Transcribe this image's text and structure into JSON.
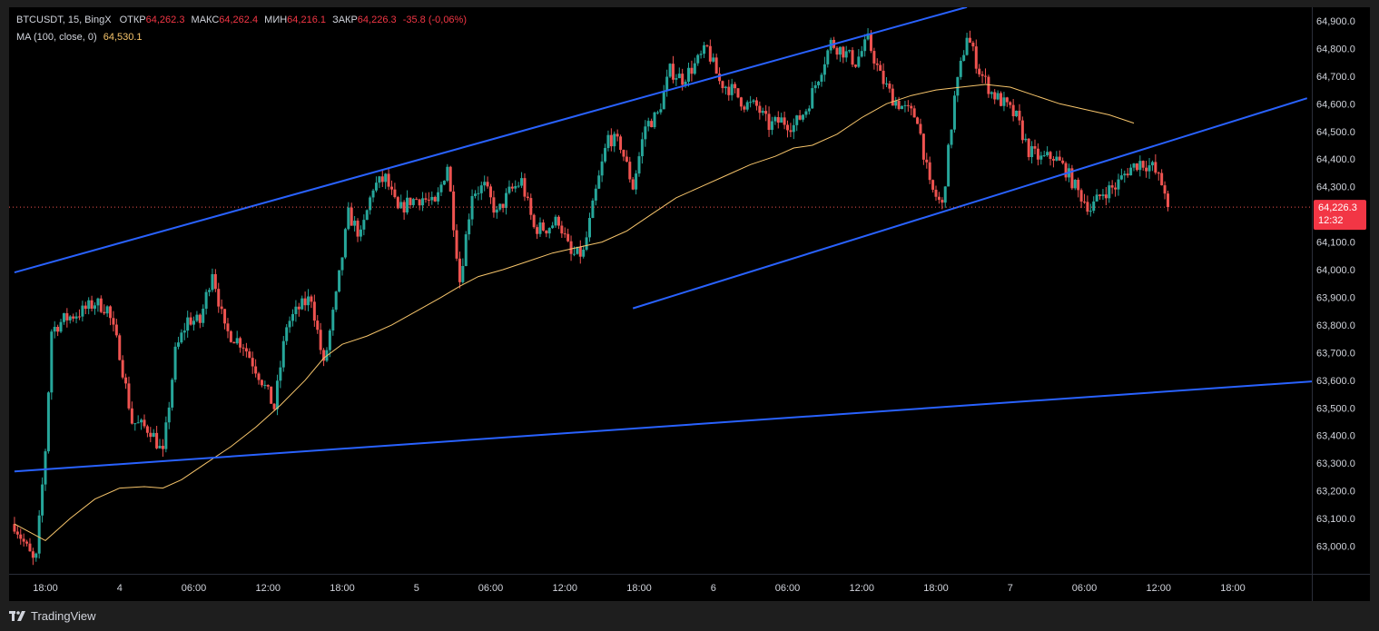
{
  "legend": {
    "symbol": "BTCUSDT, 15, BingX",
    "open_label": "ОТКР",
    "open_value": "64,262.3",
    "high_label": "МАКС",
    "high_value": "64,262.4",
    "low_label": "МИН",
    "low_value": "64,216.1",
    "close_label": "ЗАКР",
    "close_value": "64,226.3",
    "change": "-35.8 (-0,06%)",
    "ma_label": "MA (100, close, 0)",
    "ma_value": "64,530.1"
  },
  "price_badge": {
    "price": "64,226.3",
    "countdown": "12:32"
  },
  "footer": {
    "brand": "TradingView"
  },
  "colors": {
    "up": "#26a69a",
    "down": "#ef5350",
    "ma": "#f7c56b",
    "trendline": "#2962ff",
    "background": "#000000",
    "axis_text": "#d1d4dc"
  },
  "chart_data": {
    "type": "candlestick",
    "interval": "15",
    "y_ticks": [
      "63,000.0",
      "63,100.0",
      "63,200.0",
      "63,300.0",
      "63,400.0",
      "63,500.0",
      "63,600.0",
      "63,700.0",
      "63,800.0",
      "63,900.0",
      "64,000.0",
      "64,100.0",
      "64,200.0",
      "64,300.0",
      "64,400.0",
      "64,500.0",
      "64,600.0",
      "64,700.0",
      "64,800.0",
      "64,900.0"
    ],
    "y_tick_values": [
      63000,
      63100,
      63200,
      63300,
      63400,
      63500,
      63600,
      63700,
      63800,
      63900,
      64000,
      64100,
      64200,
      64300,
      64400,
      64500,
      64600,
      64700,
      64800,
      64900
    ],
    "x_ticks": [
      {
        "label": "18:00",
        "hour": 0
      },
      {
        "label": "4",
        "hour": 6
      },
      {
        "label": "06:00",
        "hour": 12
      },
      {
        "label": "12:00",
        "hour": 18
      },
      {
        "label": "18:00",
        "hour": 24
      },
      {
        "label": "5",
        "hour": 30
      },
      {
        "label": "06:00",
        "hour": 36
      },
      {
        "label": "12:00",
        "hour": 42
      },
      {
        "label": "18:00",
        "hour": 48
      },
      {
        "label": "6",
        "hour": 54
      },
      {
        "label": "06:00",
        "hour": 60
      },
      {
        "label": "12:00",
        "hour": 66
      },
      {
        "label": "18:00",
        "hour": 72
      },
      {
        "label": "7",
        "hour": 78
      },
      {
        "label": "06:00",
        "hour": 84
      },
      {
        "label": "12:00",
        "hour": 90
      },
      {
        "label": "18:00",
        "hour": 96
      }
    ],
    "y_range": [
      62900,
      64940
    ],
    "last_close": 64226.3,
    "price_path": [
      [
        -2.5,
        63080
      ],
      [
        -0.8,
        62930
      ],
      [
        0,
        63350
      ],
      [
        0.5,
        63780
      ],
      [
        1.5,
        63820
      ],
      [
        3,
        63850
      ],
      [
        4,
        63880
      ],
      [
        5,
        63860
      ],
      [
        6,
        63700
      ],
      [
        7,
        63450
      ],
      [
        8.5,
        63420
      ],
      [
        9.5,
        63330
      ],
      [
        10.5,
        63700
      ],
      [
        11.5,
        63820
      ],
      [
        12.5,
        63810
      ],
      [
        13.5,
        64000
      ],
      [
        14.5,
        63780
      ],
      [
        16,
        63730
      ],
      [
        17.5,
        63600
      ],
      [
        18.5,
        63500
      ],
      [
        19.5,
        63800
      ],
      [
        20.5,
        63860
      ],
      [
        21.5,
        63900
      ],
      [
        22.5,
        63650
      ],
      [
        23.5,
        63900
      ],
      [
        24.5,
        64200
      ],
      [
        25.5,
        64120
      ],
      [
        26.5,
        64300
      ],
      [
        27.5,
        64330
      ],
      [
        28.5,
        64210
      ],
      [
        29.5,
        64250
      ],
      [
        30.5,
        64260
      ],
      [
        31.5,
        64230
      ],
      [
        32.5,
        64380
      ],
      [
        33.5,
        63960
      ],
      [
        34.5,
        64280
      ],
      [
        35.5,
        64300
      ],
      [
        36.5,
        64200
      ],
      [
        37.5,
        64280
      ],
      [
        38.5,
        64320
      ],
      [
        39.5,
        64150
      ],
      [
        40.5,
        64150
      ],
      [
        41.5,
        64180
      ],
      [
        42.5,
        64050
      ],
      [
        43.5,
        64060
      ],
      [
        44.5,
        64280
      ],
      [
        45.5,
        64480
      ],
      [
        46.5,
        64450
      ],
      [
        47.5,
        64300
      ],
      [
        48.5,
        64520
      ],
      [
        49.5,
        64560
      ],
      [
        50.5,
        64720
      ],
      [
        51.5,
        64690
      ],
      [
        52.5,
        64740
      ],
      [
        53.5,
        64800
      ],
      [
        54.5,
        64680
      ],
      [
        55.5,
        64650
      ],
      [
        56.5,
        64600
      ],
      [
        57.5,
        64590
      ],
      [
        58.5,
        64520
      ],
      [
        59.5,
        64540
      ],
      [
        60.5,
        64520
      ],
      [
        61.5,
        64580
      ],
      [
        62.5,
        64700
      ],
      [
        63.5,
        64820
      ],
      [
        64.5,
        64790
      ],
      [
        65.5,
        64750
      ],
      [
        66.5,
        64830
      ],
      [
        67.5,
        64700
      ],
      [
        68.5,
        64620
      ],
      [
        69.5,
        64580
      ],
      [
        70.5,
        64550
      ],
      [
        71.5,
        64300
      ],
      [
        72.5,
        64230
      ],
      [
        73.5,
        64620
      ],
      [
        74.5,
        64850
      ],
      [
        75.5,
        64720
      ],
      [
        76.5,
        64640
      ],
      [
        77.5,
        64600
      ],
      [
        78.5,
        64550
      ],
      [
        79.5,
        64430
      ],
      [
        80.5,
        64400
      ],
      [
        81.5,
        64410
      ],
      [
        82.5,
        64360
      ],
      [
        83.5,
        64280
      ],
      [
        84.5,
        64220
      ],
      [
        85.5,
        64280
      ],
      [
        86.5,
        64300
      ],
      [
        87.5,
        64360
      ],
      [
        88.5,
        64390
      ],
      [
        89.5,
        64370
      ],
      [
        90.5,
        64290
      ],
      [
        90.9,
        64226.3
      ]
    ],
    "ma100_path": [
      [
        -2.5,
        63080
      ],
      [
        0,
        63020
      ],
      [
        2,
        63100
      ],
      [
        4,
        63170
      ],
      [
        6,
        63210
      ],
      [
        8,
        63215
      ],
      [
        9.5,
        63210
      ],
      [
        11,
        63240
      ],
      [
        13,
        63300
      ],
      [
        15,
        63360
      ],
      [
        17,
        63430
      ],
      [
        19,
        63510
      ],
      [
        21,
        63600
      ],
      [
        22.5,
        63680
      ],
      [
        24,
        63730
      ],
      [
        26,
        63760
      ],
      [
        28,
        63800
      ],
      [
        30,
        63850
      ],
      [
        32,
        63900
      ],
      [
        33.5,
        63940
      ],
      [
        35,
        63975
      ],
      [
        37,
        64000
      ],
      [
        39,
        64030
      ],
      [
        41,
        64060
      ],
      [
        43,
        64080
      ],
      [
        45,
        64100
      ],
      [
        47,
        64140
      ],
      [
        49,
        64200
      ],
      [
        51,
        64260
      ],
      [
        53,
        64300
      ],
      [
        55,
        64340
      ],
      [
        57,
        64380
      ],
      [
        59,
        64410
      ],
      [
        60.5,
        64440
      ],
      [
        62,
        64450
      ],
      [
        64,
        64490
      ],
      [
        66,
        64550
      ],
      [
        68,
        64600
      ],
      [
        70,
        64630
      ],
      [
        72,
        64650
      ],
      [
        74,
        64660
      ],
      [
        76,
        64670
      ],
      [
        78,
        64660
      ],
      [
        80,
        64630
      ],
      [
        82,
        64600
      ],
      [
        84,
        64580
      ],
      [
        86,
        64560
      ],
      [
        88,
        64530
      ]
    ],
    "trendlines": [
      {
        "from": [
          -2.5,
          63990
        ],
        "to": [
          74.5,
          64950
        ]
      },
      {
        "from": [
          47.5,
          63860
        ],
        "to": [
          102,
          64620
        ]
      },
      {
        "from": [
          -2.5,
          63270
        ],
        "to": [
          107,
          63610
        ]
      }
    ]
  }
}
